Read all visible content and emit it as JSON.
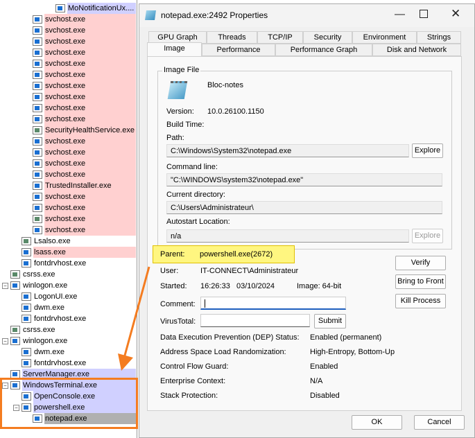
{
  "tree": [
    {
      "name": "MoNotificationUx....",
      "indent": 80,
      "hl": "lav",
      "icon": "app"
    },
    {
      "name": "svchost.exe",
      "indent": 47,
      "hl": "pink",
      "icon": "app"
    },
    {
      "name": "svchost.exe",
      "indent": 47,
      "hl": "pink",
      "icon": "app"
    },
    {
      "name": "svchost.exe",
      "indent": 47,
      "hl": "pink",
      "icon": "app"
    },
    {
      "name": "svchost.exe",
      "indent": 47,
      "hl": "pink",
      "icon": "app"
    },
    {
      "name": "svchost.exe",
      "indent": 47,
      "hl": "pink",
      "icon": "app"
    },
    {
      "name": "svchost.exe",
      "indent": 47,
      "hl": "pink",
      "icon": "app"
    },
    {
      "name": "svchost.exe",
      "indent": 47,
      "hl": "pink",
      "icon": "app"
    },
    {
      "name": "svchost.exe",
      "indent": 47,
      "hl": "pink",
      "icon": "app"
    },
    {
      "name": "svchost.exe",
      "indent": 47,
      "hl": "pink",
      "icon": "app"
    },
    {
      "name": "svchost.exe",
      "indent": 47,
      "hl": "pink",
      "icon": "app"
    },
    {
      "name": "SecurityHealthService.exe",
      "indent": 47,
      "hl": "pink",
      "icon": "gray"
    },
    {
      "name": "svchost.exe",
      "indent": 47,
      "hl": "pink",
      "icon": "app"
    },
    {
      "name": "svchost.exe",
      "indent": 47,
      "hl": "pink",
      "icon": "app"
    },
    {
      "name": "svchost.exe",
      "indent": 47,
      "hl": "pink",
      "icon": "app"
    },
    {
      "name": "svchost.exe",
      "indent": 47,
      "hl": "pink",
      "icon": "app"
    },
    {
      "name": "TrustedInstaller.exe",
      "indent": 47,
      "hl": "pink",
      "icon": "app"
    },
    {
      "name": "svchost.exe",
      "indent": 47,
      "hl": "pink",
      "icon": "app"
    },
    {
      "name": "svchost.exe",
      "indent": 47,
      "hl": "pink",
      "icon": "app"
    },
    {
      "name": "svchost.exe",
      "indent": 47,
      "hl": "pink",
      "icon": "gray"
    },
    {
      "name": "svchost.exe",
      "indent": 47,
      "hl": "pink",
      "icon": "app"
    },
    {
      "name": "Lsalso.exe",
      "indent": 31,
      "hl": "",
      "icon": "gray"
    },
    {
      "name": "lsass.exe",
      "indent": 31,
      "hl": "pink",
      "icon": "app"
    },
    {
      "name": "fontdrvhost.exe",
      "indent": 31,
      "hl": "",
      "icon": "app"
    },
    {
      "name": "csrss.exe",
      "indent": 15,
      "hl": "",
      "icon": "gray"
    },
    {
      "name": "winlogon.exe",
      "indent": 15,
      "hl": "",
      "icon": "app",
      "expand": true
    },
    {
      "name": "LogonUI.exe",
      "indent": 31,
      "hl": "",
      "icon": "app"
    },
    {
      "name": "dwm.exe",
      "indent": 31,
      "hl": "",
      "icon": "app"
    },
    {
      "name": "fontdrvhost.exe",
      "indent": 31,
      "hl": "",
      "icon": "app"
    },
    {
      "name": "csrss.exe",
      "indent": 15,
      "hl": "",
      "icon": "gray"
    },
    {
      "name": "winlogon.exe",
      "indent": 15,
      "hl": "",
      "icon": "app",
      "expand": true
    },
    {
      "name": "dwm.exe",
      "indent": 31,
      "hl": "",
      "icon": "app"
    },
    {
      "name": "fontdrvhost.exe",
      "indent": 31,
      "hl": "",
      "icon": "app"
    },
    {
      "name": "ServerManager.exe",
      "indent": 15,
      "hl": "lav",
      "icon": "app"
    },
    {
      "name": "WindowsTerminal.exe",
      "indent": 15,
      "hl": "lav",
      "icon": "app",
      "expand": true
    },
    {
      "name": "OpenConsole.exe",
      "indent": 31,
      "hl": "lav",
      "icon": "app"
    },
    {
      "name": "powershell.exe",
      "indent": 31,
      "hl": "lav",
      "icon": "app",
      "expand": true
    },
    {
      "name": "notepad.exe",
      "indent": 47,
      "hl": "sel",
      "icon": "app"
    }
  ],
  "dialog": {
    "title": "notepad.exe:2492 Properties",
    "tabs_row1": [
      "GPU Graph",
      "Threads",
      "TCP/IP",
      "Security",
      "Environment",
      "Strings"
    ],
    "tabs_row2": [
      "Image",
      "Performance",
      "Performance Graph",
      "Disk and Network"
    ],
    "group_title": "Image File",
    "description": "Bloc-notes",
    "version_label": "Version:",
    "version": "10.0.26100.1150",
    "build_label": "Build Time:",
    "path_label": "Path:",
    "path": "C:\\Windows\\System32\\notepad.exe",
    "explore": "Explore",
    "cmd_label": "Command line:",
    "cmd": "\"C:\\WINDOWS\\system32\\notepad.exe\"",
    "cwd_label": "Current directory:",
    "cwd": "C:\\Users\\Administrateur\\",
    "autostart_label": "Autostart Location:",
    "autostart": "n/a",
    "parent_label": "Parent:",
    "parent": "powershell.exe(2672)",
    "user_label": "User:",
    "user": "IT-CONNECT\\Administrateur",
    "started_label": "Started:",
    "started": "16:26:33   03/10/2024",
    "image_bits": "Image: 64-bit",
    "comment_label": "Comment:",
    "comment": "",
    "virustotal_label": "VirusTotal:",
    "submit": "Submit",
    "verify": "Verify",
    "bring_to_front": "Bring to Front",
    "kill": "Kill Process",
    "props": [
      {
        "k": "Data Execution Prevention (DEP) Status:",
        "v": "Enabled (permanent)"
      },
      {
        "k": "Address Space Load Randomization:",
        "v": "High-Entropy, Bottom-Up"
      },
      {
        "k": "Control Flow Guard:",
        "v": "Enabled"
      },
      {
        "k": "Enterprise Context:",
        "v": "N/A"
      },
      {
        "k": "Stack Protection:",
        "v": "Disabled"
      }
    ],
    "ok": "OK",
    "cancel": "Cancel"
  },
  "colors": {
    "highlight_pink": "#ffd0d0",
    "highlight_lavender": "#d0d0ff",
    "annotation": "#f47c20",
    "parent_highlight": "#fff680"
  }
}
